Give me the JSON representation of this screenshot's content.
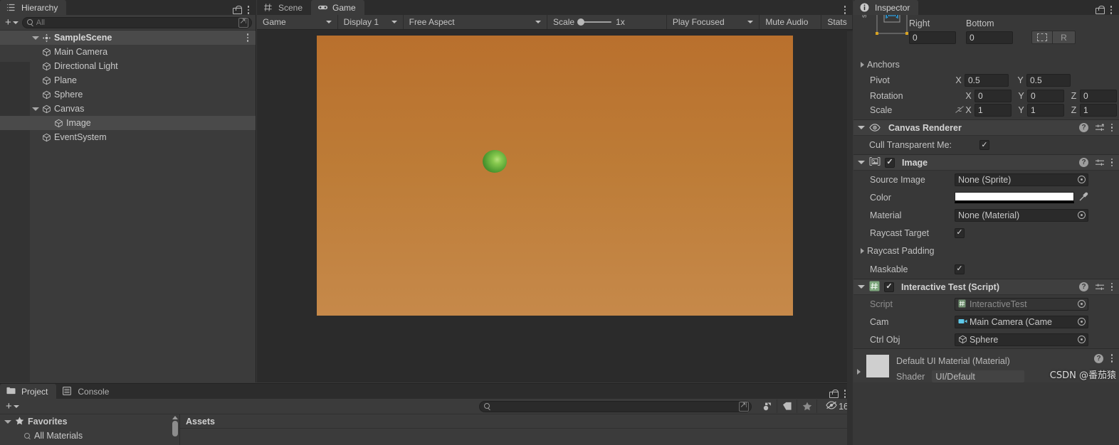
{
  "hierarchy": {
    "tab_label": "Hierarchy",
    "tab_icon": "hierarchy-icon",
    "create_label": "+",
    "search_placeholder": "All",
    "items": [
      {
        "label": "SampleScene",
        "depth": 0,
        "type": "scene",
        "expanded": true,
        "selected": false
      },
      {
        "label": "Main Camera",
        "depth": 1,
        "type": "gameobject",
        "expanded": false,
        "selected": false
      },
      {
        "label": "Directional Light",
        "depth": 1,
        "type": "gameobject",
        "expanded": false,
        "selected": false
      },
      {
        "label": "Plane",
        "depth": 1,
        "type": "gameobject",
        "expanded": false,
        "selected": false
      },
      {
        "label": "Sphere",
        "depth": 1,
        "type": "gameobject",
        "expanded": false,
        "selected": false
      },
      {
        "label": "Canvas",
        "depth": 1,
        "type": "gameobject",
        "expanded": true,
        "selected": false
      },
      {
        "label": "Image",
        "depth": 2,
        "type": "gameobject",
        "expanded": false,
        "selected": true
      },
      {
        "label": "EventSystem",
        "depth": 1,
        "type": "gameobject",
        "expanded": false,
        "selected": false
      }
    ]
  },
  "gameview": {
    "tabs": [
      {
        "label": "Scene",
        "icon": "grid-icon",
        "active": false
      },
      {
        "label": "Game",
        "icon": "gamepad-icon",
        "active": true
      }
    ],
    "toolbar": {
      "target_display": "Game",
      "display": "Display 1",
      "aspect": "Free Aspect",
      "scale_label": "Scale",
      "scale_value": "1x",
      "play_mode": "Play Focused",
      "mute_audio": "Mute Audio",
      "stats": "Stats"
    },
    "render": {
      "background_top": "#b9702d",
      "background_bottom": "#c6894a",
      "sphere_color": "#4f9b31"
    }
  },
  "inspector": {
    "tab_label": "Inspector",
    "tab_icon": "info-icon",
    "rect_transform": {
      "anchor_preset_label": "stretch",
      "right_label": "Right",
      "right_value": "0",
      "bottom_label": "Bottom",
      "bottom_value": "0",
      "blueprint_btn": "blueprint-mode-icon",
      "raw_btn": "R",
      "anchors_label": "Anchors",
      "pivot_label": "Pivot",
      "pivot_x_axis": "X",
      "pivot_x": "0.5",
      "pivot_y_axis": "Y",
      "pivot_y": "0.5",
      "rotation_label": "Rotation",
      "rotation_x": "0",
      "rotation_y": "0",
      "rotation_z": "0",
      "scale_label": "Scale",
      "scale_x": "1",
      "scale_y": "1",
      "scale_z": "1",
      "axis_x": "X",
      "axis_y": "Y",
      "axis_z": "Z"
    },
    "components": [
      {
        "name": "Canvas Renderer",
        "icon": "eye-icon",
        "enabled": null,
        "expanded": true,
        "rows": [
          {
            "label": "Cull Transparent Me:",
            "type": "checkbox",
            "value": true
          }
        ]
      },
      {
        "name": "Image",
        "icon": "image-icon",
        "enabled": true,
        "expanded": true,
        "rows": [
          {
            "label": "Source Image",
            "type": "object",
            "value": "None (Sprite)"
          },
          {
            "label": "Color",
            "type": "color",
            "value": "#FFFFFF"
          },
          {
            "label": "Material",
            "type": "object",
            "value": "None (Material)"
          },
          {
            "label": "Raycast Target",
            "type": "checkbox",
            "value": true
          },
          {
            "label": "Raycast Padding",
            "type": "foldout",
            "value": ""
          },
          {
            "label": "Maskable",
            "type": "checkbox",
            "value": true
          }
        ]
      },
      {
        "name": "Interactive Test (Script)",
        "icon": "script-icon",
        "enabled": true,
        "expanded": true,
        "rows": [
          {
            "label": "Script",
            "type": "object-disabled",
            "value": "InteractiveTest",
            "value_icon": "script-file-icon"
          },
          {
            "label": "Cam",
            "type": "object",
            "value": "Main Camera (Came",
            "value_icon": "camera-icon"
          },
          {
            "label": "Ctrl Obj",
            "type": "object",
            "value": "Sphere",
            "value_icon": "cube-icon"
          }
        ]
      }
    ],
    "material_preview": {
      "title": "Default UI Material (Material)",
      "shader_label": "Shader",
      "shader_value": "UI/Default"
    }
  },
  "project": {
    "tabs": [
      {
        "label": "Project",
        "icon": "folder-icon",
        "active": true
      },
      {
        "label": "Console",
        "icon": "console-icon",
        "active": false
      }
    ],
    "create_label": "+",
    "search_placeholder": "",
    "icon_buttons": [
      "object-filter-icon",
      "label-filter-icon",
      "favorite-filter-icon"
    ],
    "hidden_count_icon": "hidden-eye-icon",
    "hidden_count": "16",
    "tree": [
      {
        "label": "Favorites",
        "depth": 0,
        "icon": "star-icon",
        "expanded": true
      },
      {
        "label": "All Materials",
        "depth": 1,
        "icon": "search-icon",
        "expanded": false
      }
    ],
    "assets_header": "Assets"
  },
  "watermark": "CSDN @番茄猿"
}
